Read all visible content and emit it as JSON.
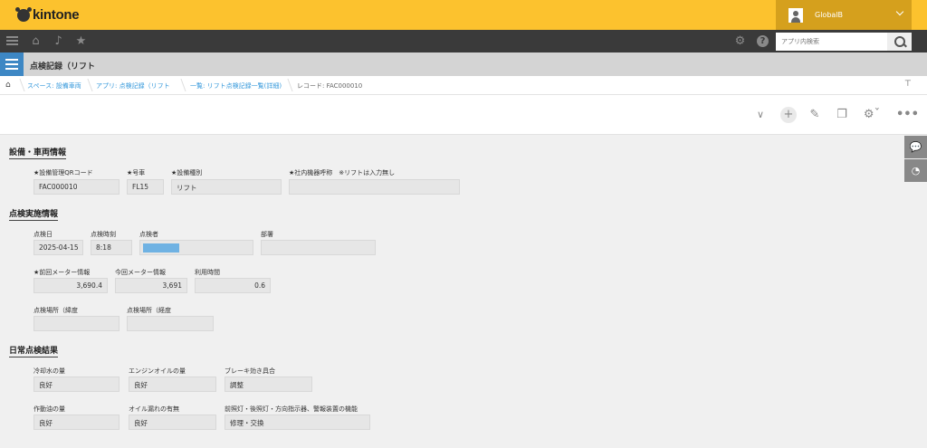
{
  "header": {
    "brand": "kintone",
    "user_name": "GlobalB"
  },
  "nav": {
    "icons": [
      "menu-icon",
      "home-icon",
      "bell-icon",
      "star-icon",
      "gear-icon",
      "help-icon"
    ],
    "search_placeholder": "アプリ内検索"
  },
  "app": {
    "title": "点検記録（リフト"
  },
  "breadcrumb": {
    "space": "スペース: 設備車両",
    "app": "アプリ: 点検記録（リフト",
    "view": "一覧: リフト点検記録一覧(詳細)",
    "record": "レコード: FAC000010"
  },
  "toolbar": {
    "icons": [
      "chevron-down-icon",
      "add-icon",
      "edit-icon",
      "copy-icon",
      "gear-icon",
      "more-icon"
    ]
  },
  "side_tabs": [
    "comment-icon",
    "history-icon"
  ],
  "sections": {
    "equipment": {
      "title": "設備・車両情報",
      "fields": [
        {
          "label": "★設備管理QRコード",
          "value": "FAC000010"
        },
        {
          "label": "★号車",
          "value": "FL15"
        },
        {
          "label": "★設備種別",
          "value": "リフト"
        },
        {
          "label": "★社内機器呼称　※リフトは入力無し",
          "value": ""
        }
      ]
    },
    "inspection": {
      "title": "点検実施情報",
      "date_label": "点検日",
      "date_value": "2025-04-15",
      "time_label": "点検時刻",
      "time_value": "8:18",
      "inspector_label": "点検者",
      "dept_label": "部署",
      "dept_value": "",
      "prev_meter_label": "★前回メーター情報",
      "prev_meter_value": "3,690.4",
      "cur_meter_label": "今回メーター情報",
      "cur_meter_value": "3,691",
      "usage_label": "利用時間",
      "usage_value": "0.6",
      "lat_label": "点検場所（緯度",
      "lat_value": "",
      "lng_label": "点検場所（経度",
      "lng_value": ""
    },
    "daily": {
      "title": "日常点検結果",
      "fields": [
        {
          "label": "冷却水の量",
          "value": "良好"
        },
        {
          "label": "エンジンオイルの量",
          "value": "良好"
        },
        {
          "label": "ブレーキ効き具合",
          "value": "調整"
        },
        {
          "label": "作動油の量",
          "value": "良好"
        },
        {
          "label": "オイル漏れの有無",
          "value": "良好"
        },
        {
          "label": "前照灯・後照灯・方向指示器、警報装置の機能",
          "value": "修理・交換"
        }
      ]
    }
  }
}
